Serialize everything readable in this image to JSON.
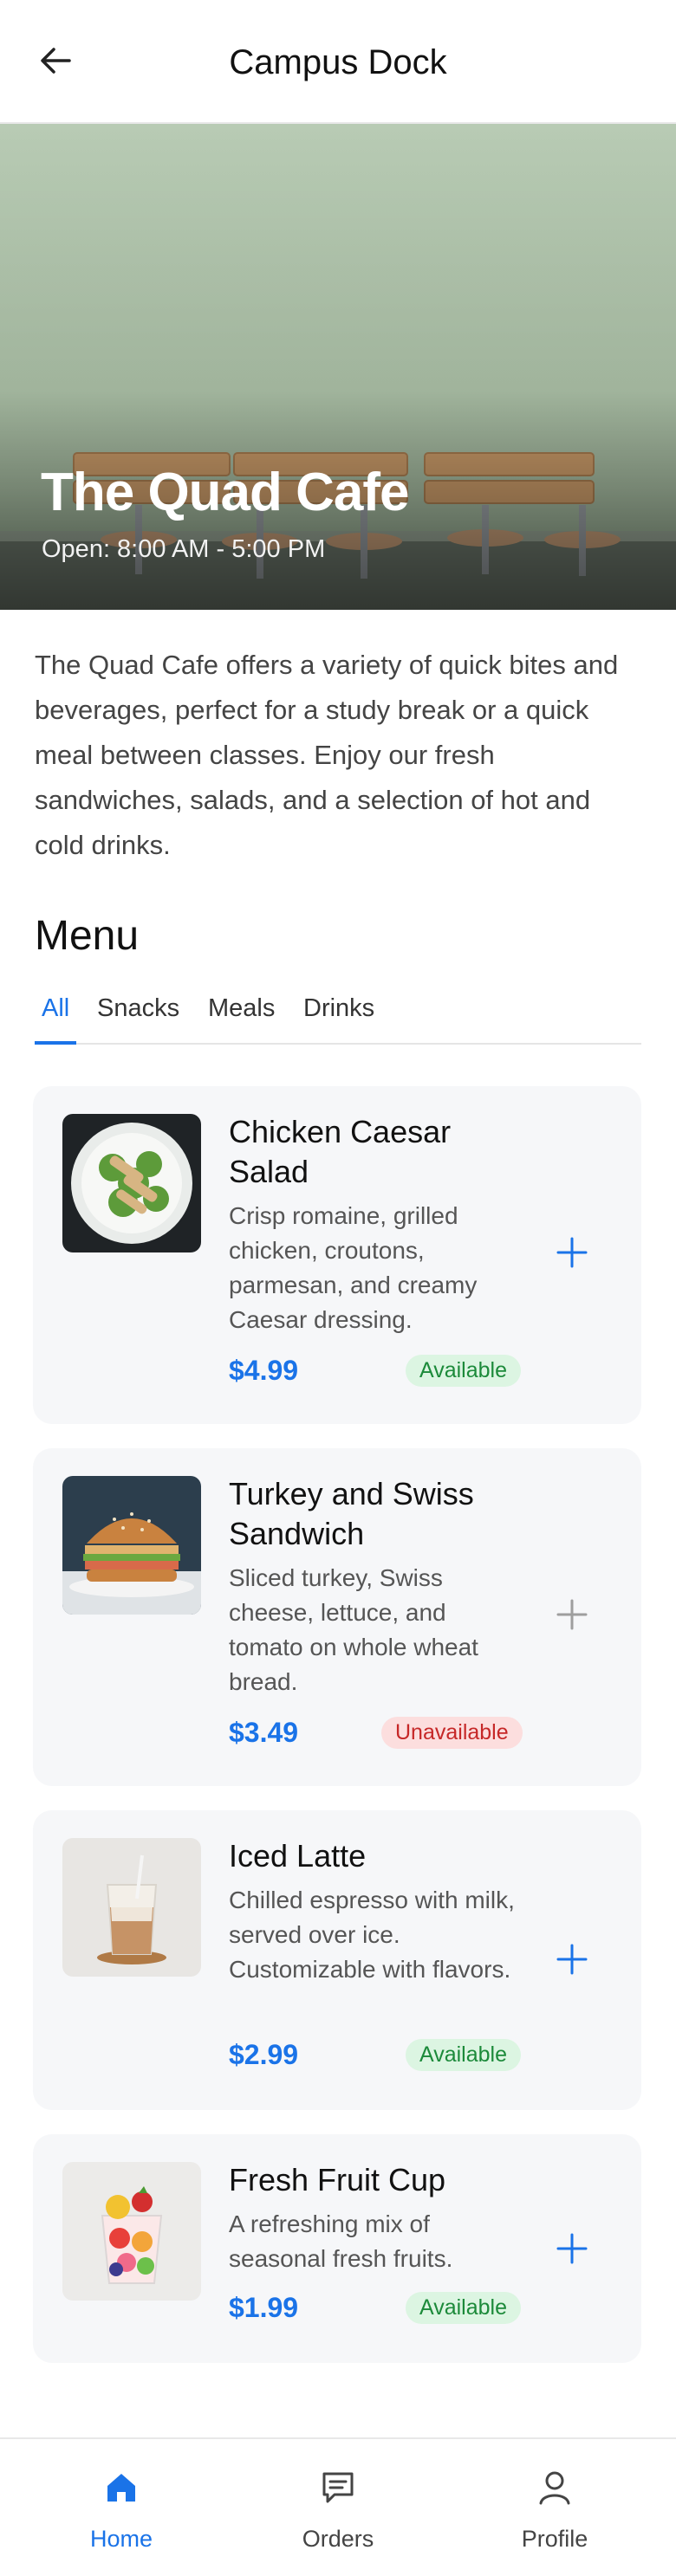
{
  "header": {
    "title": "Campus Dock",
    "back_icon": "arrow-left-icon"
  },
  "hero": {
    "title": "The Quad Cafe",
    "hours": "Open: 8:00 AM - 5:00 PM"
  },
  "description": "The Quad Cafe offers a variety of quick bites and beverages, perfect for a study break or a quick meal between classes. Enjoy our fresh sandwiches, salads, and a selection of hot and cold drinks.",
  "menu": {
    "title": "Menu",
    "tabs": [
      "All",
      "Snacks",
      "Meals",
      "Drinks"
    ],
    "active_tab": "All",
    "items": [
      {
        "name": "Chicken Caesar Salad",
        "description": "Crisp romaine, grilled chicken, croutons, parmesan, and creamy Caesar dressing.",
        "price": "$4.99",
        "status": "Available"
      },
      {
        "name": "Turkey and Swiss Sandwich",
        "description": "Sliced turkey, Swiss cheese, lettuce, and tomato on whole wheat bread.",
        "price": "$3.49",
        "status": "Unavailable"
      },
      {
        "name": "Iced Latte",
        "description": "Chilled espresso with milk, served over ice. Customizable with flavors.",
        "price": "$2.99",
        "status": "Available"
      },
      {
        "name": "Fresh Fruit Cup",
        "description": "A refreshing mix of seasonal fresh fruits.",
        "price": "$1.99",
        "status": "Available"
      }
    ]
  },
  "nav": {
    "items": [
      {
        "label": "Home",
        "icon": "home-icon"
      },
      {
        "label": "Orders",
        "icon": "receipt-icon"
      },
      {
        "label": "Profile",
        "icon": "user-icon"
      }
    ],
    "active": "Home"
  },
  "colors": {
    "accent": "#1a73e8",
    "available": "#1c8a3a",
    "unavailable": "#c62828"
  }
}
